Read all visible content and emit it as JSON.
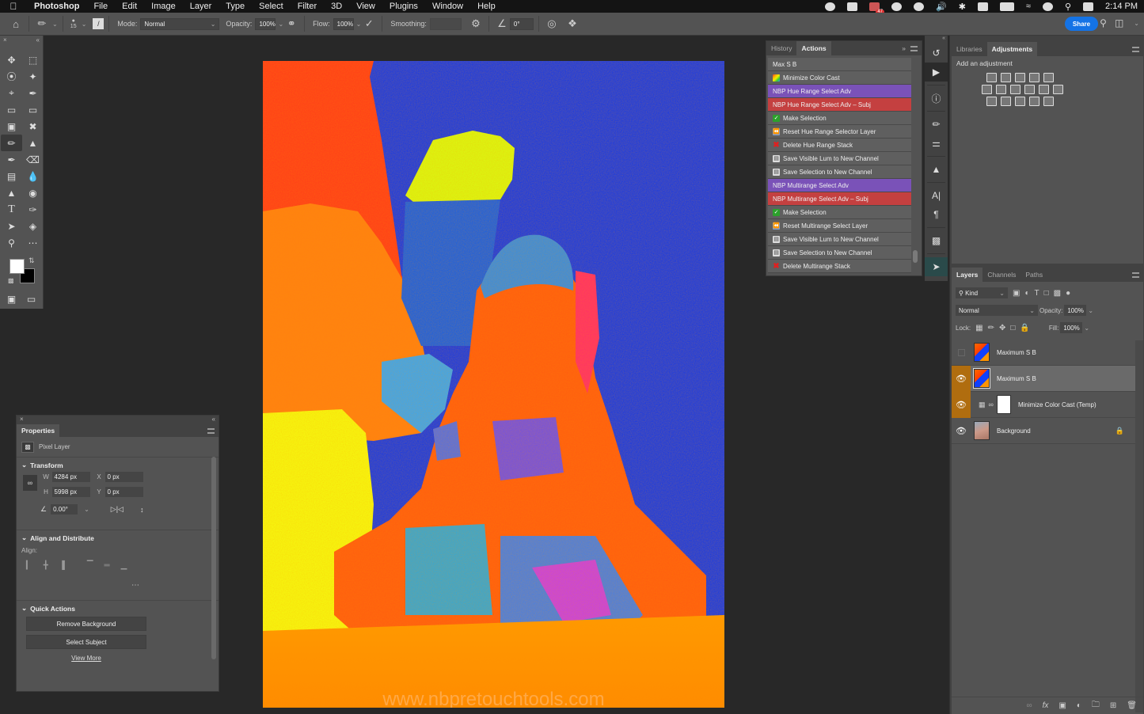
{
  "menubar": {
    "apple_icon": "apple-logo",
    "items": [
      "Photoshop",
      "File",
      "Edit",
      "Image",
      "Layer",
      "Type",
      "Select",
      "Filter",
      "3D",
      "View",
      "Plugins",
      "Window",
      "Help"
    ],
    "notification_badge": "47",
    "clock": "2:14 PM"
  },
  "options_bar": {
    "brush_size": "15",
    "mode_label": "Mode:",
    "mode_value": "Normal",
    "opacity_label": "Opacity:",
    "opacity_value": "100%",
    "flow_label": "Flow:",
    "flow_value": "100%",
    "smoothing_label": "Smoothing:",
    "smoothing_value": "",
    "angle_value": "0°",
    "share_label": "Share"
  },
  "actions_panel": {
    "tabs": [
      "History",
      "Actions"
    ],
    "active_tab": "Actions",
    "items": [
      {
        "label": "Max S B",
        "style": "plain",
        "icon": ""
      },
      {
        "label": "Minimize Color Cast",
        "style": "plain",
        "icon": "rainbow"
      },
      {
        "label": "NBP Hue Range Select Adv",
        "style": "purple",
        "icon": ""
      },
      {
        "label": "NBP Hue Range Select Adv – Subj",
        "style": "red",
        "icon": ""
      },
      {
        "label": "Make Selection",
        "style": "plain",
        "icon": "check"
      },
      {
        "label": "Reset Hue Range Selector Layer",
        "style": "plain",
        "icon": "rewind"
      },
      {
        "label": "Delete Hue Range Stack",
        "style": "plain",
        "icon": "x"
      },
      {
        "label": "Save Visible Lum to New Channel",
        "style": "plain",
        "icon": "disk"
      },
      {
        "label": "Save Selection to New Channel",
        "style": "plain",
        "icon": "disk"
      },
      {
        "label": "NBP Multirange Select Adv",
        "style": "purple",
        "icon": ""
      },
      {
        "label": "NBP Multirange Select Adv – Subj",
        "style": "red",
        "icon": ""
      },
      {
        "label": "Make Selection",
        "style": "plain",
        "icon": "check"
      },
      {
        "label": "Reset Multirange Select Layer",
        "style": "plain",
        "icon": "rewind"
      },
      {
        "label": "Save Visible Lum to New Channel",
        "style": "plain",
        "icon": "disk"
      },
      {
        "label": "Save Selection to New Channel",
        "style": "plain",
        "icon": "disk"
      },
      {
        "label": "Delete Multirange Stack",
        "style": "plain",
        "icon": "x"
      }
    ]
  },
  "adjustments_panel": {
    "tabs": [
      "Libraries",
      "Adjustments"
    ],
    "active_tab": "Adjustments",
    "subtitle": "Add an adjustment"
  },
  "layers_panel": {
    "tabs": [
      "Layers",
      "Channels",
      "Paths"
    ],
    "active_tab": "Layers",
    "filter_label": "Kind",
    "blend_mode": "Normal",
    "opacity_label": "Opacity:",
    "opacity_value": "100%",
    "lock_label": "Lock:",
    "fill_label": "Fill:",
    "fill_value": "100%",
    "layers": [
      {
        "name": "Maximum S B",
        "visible": false,
        "selected": false,
        "type": "pixel"
      },
      {
        "name": "Maximum S B",
        "visible": true,
        "selected": true,
        "type": "pixel"
      },
      {
        "name": "Minimize Color Cast (Temp)",
        "visible": true,
        "selected": false,
        "type": "adjustment"
      },
      {
        "name": "Background",
        "visible": true,
        "selected": false,
        "type": "background",
        "locked": true
      }
    ]
  },
  "properties_panel": {
    "title": "Properties",
    "layer_kind": "Pixel Layer",
    "transform_title": "Transform",
    "w_label": "W",
    "w_value": "4284 px",
    "h_label": "H",
    "h_value": "5998 px",
    "x_label": "X",
    "x_value": "0 px",
    "y_label": "Y",
    "y_value": "0 px",
    "angle_value": "0.00°",
    "align_title": "Align and Distribute",
    "align_label": "Align:",
    "quick_actions_title": "Quick Actions",
    "remove_bg_label": "Remove Background",
    "select_subject_label": "Select Subject",
    "view_more_label": "View More"
  },
  "canvas": {
    "watermark": "www.nbpretouchtools.com"
  }
}
